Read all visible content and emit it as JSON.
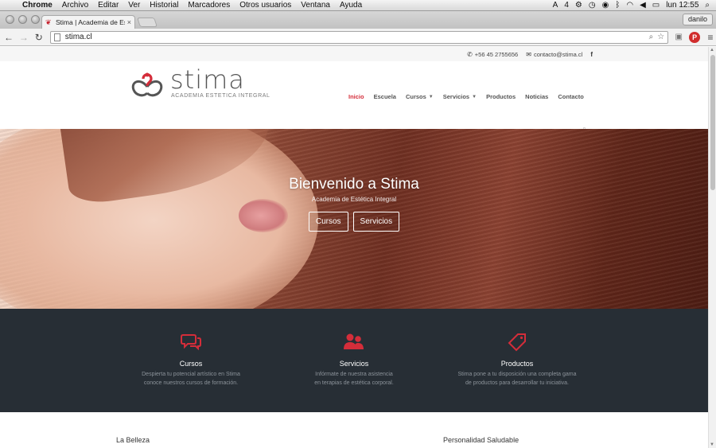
{
  "os_menubar": {
    "app_name": "Chrome",
    "menus": [
      "Archivo",
      "Editar",
      "Ver",
      "Historial",
      "Marcadores",
      "Otros usuarios",
      "Ventana",
      "Ayuda"
    ],
    "status": {
      "badge": "4",
      "clock": "lun 12:55"
    }
  },
  "browser": {
    "tab_title": "Stima | Academia de Estét",
    "profile": "danilo",
    "url": "stima.cl"
  },
  "site": {
    "topbar": {
      "phone": "+56 45 2755656",
      "email": "contacto@stima.cl",
      "social": "f"
    },
    "logo": {
      "text": "stima",
      "tagline": "ACADEMIA ESTETICA INTEGRAL",
      "brand_color": "#d42d3a"
    },
    "nav": [
      {
        "label": "Inicio",
        "active": true,
        "dropdown": false
      },
      {
        "label": "Escuela",
        "active": false,
        "dropdown": false
      },
      {
        "label": "Cursos",
        "active": false,
        "dropdown": true
      },
      {
        "label": "Servicios",
        "active": false,
        "dropdown": true
      },
      {
        "label": "Productos",
        "active": false,
        "dropdown": false
      },
      {
        "label": "Noticias",
        "active": false,
        "dropdown": false
      },
      {
        "label": "Contacto",
        "active": false,
        "dropdown": false
      }
    ],
    "hero": {
      "title": "Bienvenido a Stima",
      "subtitle": "Academia de Estética Integral",
      "buttons": [
        "Cursos",
        "Servicios"
      ]
    },
    "features": [
      {
        "icon": "chat-bubbles-icon",
        "title": "Cursos",
        "desc_line1": "Despierta tu potencial artístico en Stima",
        "desc_line2": "conoce nuestros cursos de formación."
      },
      {
        "icon": "people-icon",
        "title": "Servicios",
        "desc_line1": "Infórmate de nuestra asistencia",
        "desc_line2": "en terapias de estética corporal."
      },
      {
        "icon": "tag-icon",
        "title": "Productos",
        "desc_line1": "Stima pone a tu disposición una completa gama",
        "desc_line2": "de productos para desarrollar tu iniciativa."
      }
    ],
    "bottom": {
      "left_heading": "La Belleza",
      "right_heading": "Personalidad Saludable"
    }
  },
  "colors": {
    "accent": "#d42d3a",
    "dark_band": "#272e35"
  }
}
